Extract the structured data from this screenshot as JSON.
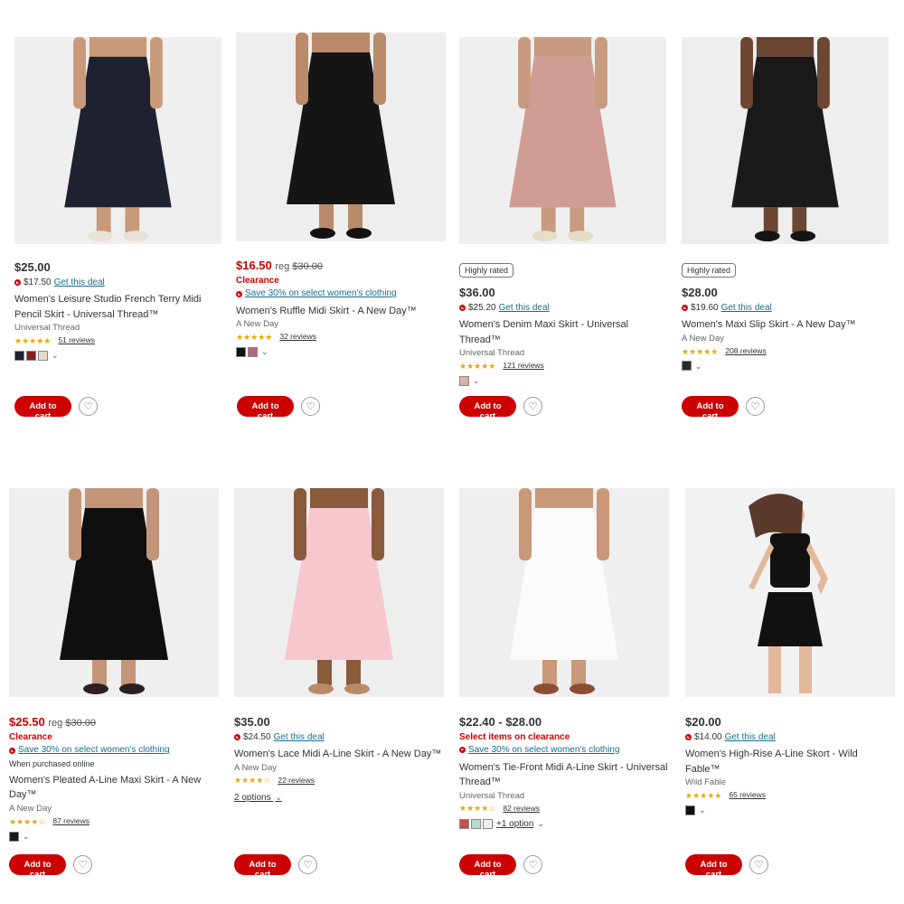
{
  "action_labels": {
    "add_to_cart": "Add to cart",
    "heart": "♡",
    "chevron": "⌄"
  },
  "products": [
    {
      "price": "$25.00",
      "deal_price": "$17.50",
      "deal_link": "Get this deal",
      "title": "Women's Leisure Studio French Terry Midi Pencil Skirt - Universal Thread™",
      "brand": "Universal Thread",
      "stars": "★★★★★",
      "reviews": "51 reviews",
      "swatches": [
        "#1f2230",
        "#8b1c1c",
        "#e6dcc8"
      ],
      "image_colors": {
        "bg": "#efefef",
        "garment": "#1e2130",
        "skin": "#c99a7a",
        "shoe": "#e8e2d6"
      }
    },
    {
      "price": "$16.50",
      "reg": "reg",
      "reg_price": "$30.00",
      "clearance": "Clearance",
      "promo": "Save 30% on select women's clothing",
      "title": "Women's Ruffle Midi Skirt - A New Day™",
      "brand": "A New Day",
      "stars": "★★★★★",
      "reviews": "32 reviews",
      "swatches": [
        "#111111",
        "#b7687a"
      ],
      "image_colors": {
        "bg": "#eeeeee",
        "garment": "#151515",
        "skin": "#b98b6b",
        "shoe": "#111111"
      }
    },
    {
      "badge": "Highly rated",
      "price": "$36.00",
      "deal_price": "$25.20",
      "deal_link": "Get this deal",
      "title": "Women's Denim Maxi Skirt - Universal Thread™",
      "brand": "Universal Thread",
      "stars": "★★★★★",
      "reviews": "121 reviews",
      "swatches": [
        "#d9b3aa"
      ],
      "image_colors": {
        "bg": "#efefef",
        "garment": "#cf9d94",
        "skin": "#c89b80",
        "shoe": "#e8dcc6"
      }
    },
    {
      "badge": "Highly rated",
      "price": "$28.00",
      "deal_price": "$19.60",
      "deal_link": "Get this deal",
      "title": "Women's Maxi Slip Skirt - A New Day™",
      "brand": "A New Day",
      "stars": "★★★★★",
      "reviews": "208 reviews",
      "swatches": [
        "#2a2a2a"
      ],
      "image_colors": {
        "bg": "#eeeeee",
        "garment": "#1a1a1a",
        "skin": "#6b4632",
        "shoe": "#151515"
      }
    },
    {
      "price": "$25.50",
      "reg": "reg",
      "reg_price": "$30.00",
      "clearance": "Clearance",
      "promo": "Save 30% on select women's clothing",
      "note": "When purchased online",
      "title": "Women's Pleated A-Line Maxi Skirt - A New Day™",
      "brand": "A New Day",
      "stars": "★★★★☆",
      "reviews": "87 reviews",
      "swatches": [
        "#1a1a1a"
      ],
      "image_colors": {
        "bg": "#efefef",
        "garment": "#0f0f0f",
        "skin": "#c3967a",
        "shoe": "#2b2020"
      }
    },
    {
      "price": "$35.00",
      "deal_price": "$24.50",
      "deal_link": "Get this deal",
      "title": "Women's Lace Midi A-Line Skirt - A New Day™",
      "brand": "A New Day",
      "stars": "★★★★☆",
      "reviews": "22 reviews",
      "options": "2 options",
      "image_colors": {
        "bg": "#eeeeee",
        "garment": "#f6c7cf",
        "skin": "#8a5a3c",
        "shoe": "#b98a66"
      }
    },
    {
      "price": "$22.40 - $28.00",
      "clearance": "Select items on clearance",
      "promo": "Save 30% on select women's clothing",
      "title": "Women's Tie-Front Midi A-Line Skirt - Universal Thread™",
      "brand": "Universal Thread",
      "stars": "★★★★☆",
      "reviews": "82 reviews",
      "swatches": [
        "#c0524a",
        "#b9dccc",
        "#efefea"
      ],
      "plus_option": "+1 option",
      "image_colors": {
        "bg": "#efefef",
        "garment": "#fbfbfb",
        "skin": "#c89878",
        "shoe": "#8c4e33"
      }
    },
    {
      "price": "$20.00",
      "deal_price": "$14.00",
      "deal_link": "Get this deal",
      "title": "Women's High-Rise A-Line Skort - Wild Fable™",
      "brand": "Wild Fable",
      "stars": "★★★★★",
      "reviews": "65 reviews",
      "swatches": [
        "#111111"
      ],
      "image_colors": {
        "bg": "#f2f2f2",
        "garment": "#111111",
        "skin": "#e2b89c",
        "shoe": "#111111"
      }
    }
  ]
}
